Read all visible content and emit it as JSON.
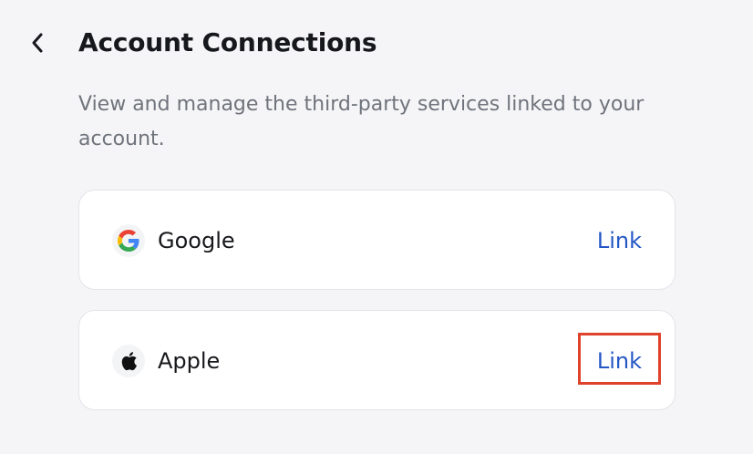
{
  "header": {
    "back_icon": "chevron-left-icon",
    "title": "Account Connections"
  },
  "description": "View and manage the third-party services linked to your account.",
  "connections": [
    {
      "name": "Google",
      "icon": "google-icon",
      "action_label": "Link",
      "action_color": "#2457c5"
    },
    {
      "name": "Apple",
      "icon": "apple-icon",
      "action_label": "Link",
      "action_color": "#2457c5",
      "highlighted": true,
      "highlight_color": "#e0432b"
    }
  ],
  "colors": {
    "background": "#f5f5f7",
    "card": "#ffffff",
    "text_primary": "#17181c",
    "text_secondary": "#6f737b",
    "link": "#2457c5"
  }
}
